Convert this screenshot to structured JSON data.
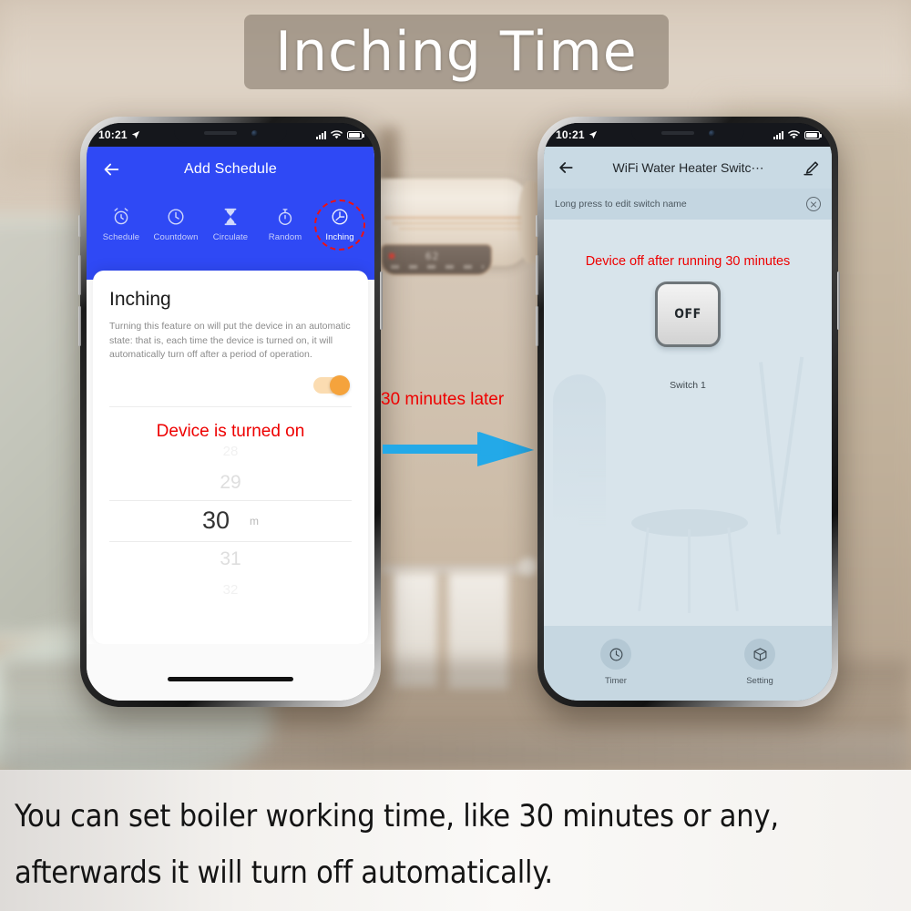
{
  "title_banner": {
    "text": "Inching Time"
  },
  "left_phone": {
    "status_bar": {
      "time": "10:21",
      "location_icon": "location-arrow-icon",
      "signal_icon": "signal-bars-icon",
      "wifi_icon": "wifi-icon",
      "battery_icon": "battery-icon"
    },
    "header": {
      "back_icon": "back-arrow-icon",
      "title": "Add Schedule"
    },
    "tabs": [
      {
        "label": "Schedule",
        "icon": "alarm-clock-icon"
      },
      {
        "label": "Countdown",
        "icon": "clock-icon"
      },
      {
        "label": "Circulate",
        "icon": "hourglass-icon"
      },
      {
        "label": "Random",
        "icon": "stopwatch-icon"
      },
      {
        "label": "Inching",
        "icon": "inching-clock-icon"
      }
    ],
    "sheet": {
      "title": "Inching",
      "description": "Turning this feature on will put the device in an automatic state: that is, each time the device is turned on, it will automatically turn off after a period of operation.",
      "toggle_state": "on",
      "toggle_color": "#f5a33c"
    },
    "annotation": {
      "text": "Device is turned on",
      "color": "#ee0000"
    },
    "picker": {
      "above2": "28",
      "above1": "29",
      "selected": "30",
      "unit": "m",
      "below1": "31",
      "below2": "32"
    }
  },
  "middle": {
    "note": "30 minutes later",
    "note_color": "#ee0000",
    "arrow_icon": "right-arrow-icon",
    "arrow_color": "#23a9e8"
  },
  "right_phone": {
    "status_bar": {
      "time": "10:21",
      "location_icon": "location-arrow-icon",
      "signal_icon": "signal-bars-icon",
      "wifi_icon": "wifi-icon",
      "battery_icon": "battery-icon"
    },
    "header": {
      "back_icon": "back-arrow-icon",
      "title": "WiFi Water Heater Switc⋯",
      "edit_icon": "pencil-icon"
    },
    "hint_bar": {
      "text": "Long press to edit switch name",
      "close_icon": "close-circle-icon"
    },
    "annotation": {
      "text": "Device off after running 30 minutes",
      "color": "#ee0000"
    },
    "switch": {
      "state_label": "OFF",
      "name": "Switch 1"
    },
    "bottom_nav": [
      {
        "label": "Timer",
        "icon": "clock-icon"
      },
      {
        "label": "Setting",
        "icon": "cube-icon"
      }
    ]
  },
  "caption": {
    "line1": "You can set boiler working time, like 30 minutes or any,",
    "line2": "afterwards it will turn off automatically."
  },
  "colors": {
    "app_blue": "#2f49f5",
    "accent_orange": "#f5a33c",
    "annotation_red": "#ee0000",
    "arrow_blue": "#23a9e8"
  }
}
